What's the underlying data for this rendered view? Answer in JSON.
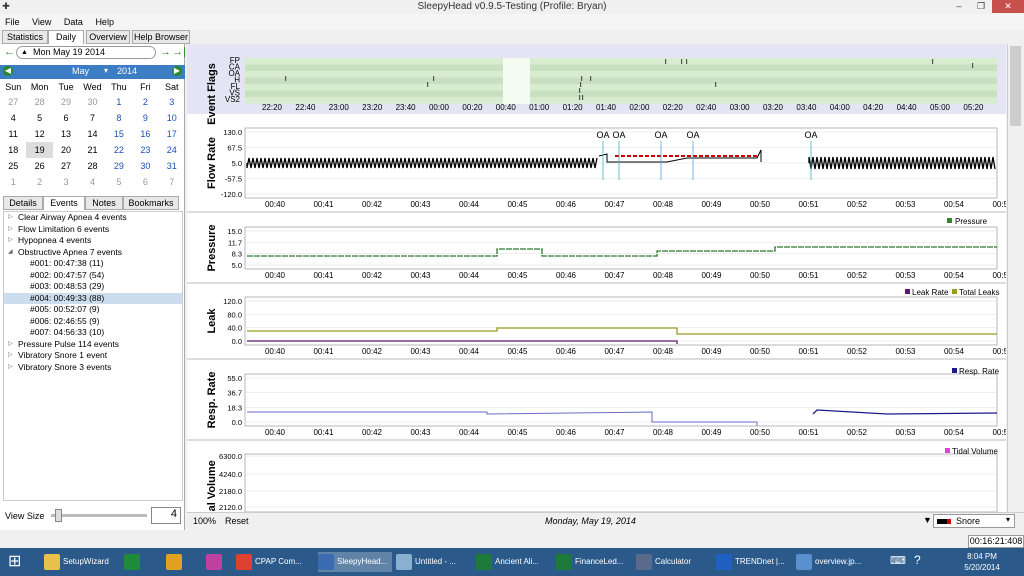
{
  "window": {
    "title": "SleepyHead v0.9.5-Testing (Profile: Bryan)"
  },
  "menu": [
    "File",
    "View",
    "Data",
    "Help"
  ],
  "tabs": [
    "Statistics",
    "Daily",
    "Overview",
    "Help Browser"
  ],
  "date": {
    "value": "Mon May 19 2014",
    "month": "May",
    "year": "2014"
  },
  "calendar": {
    "headers": [
      "Sun",
      "Mon",
      "Tue",
      "Wed",
      "Thu",
      "Fri",
      "Sat"
    ],
    "rows": [
      [
        "27",
        "28",
        "29",
        "30",
        "1",
        "2",
        "3"
      ],
      [
        "4",
        "5",
        "6",
        "7",
        "8",
        "9",
        "10"
      ],
      [
        "11",
        "12",
        "13",
        "14",
        "15",
        "16",
        "17"
      ],
      [
        "18",
        "19",
        "20",
        "21",
        "22",
        "23",
        "24"
      ],
      [
        "25",
        "26",
        "27",
        "28",
        "29",
        "30",
        "31"
      ],
      [
        "1",
        "2",
        "3",
        "4",
        "5",
        "6",
        "7"
      ]
    ]
  },
  "subtabs": [
    "Details",
    "Events",
    "Notes",
    "Bookmarks"
  ],
  "events": [
    "Clear Airway Apnea 4 events",
    "Flow Limitation 6 events",
    "Hypopnea 4 events",
    "Obstructive Apnea 7 events",
    "#001: 00:47:38 (11)",
    "#002: 00:47:57 (54)",
    "#003: 00:48:53 (29)",
    "#004: 00:49:33 (88)",
    "#005: 00:52:07 (9)",
    "#006: 02:46:55 (9)",
    "#007: 04:56:33 (10)",
    "Pressure Pulse 114 events",
    "Vibratory Snore 1 event",
    "Vibratory Snore 3 events"
  ],
  "viewsize": {
    "label": "View Size",
    "value": "4"
  },
  "graphs": {
    "flags": {
      "title": "Event Flags",
      "labels": [
        "FP",
        "CA",
        "OA",
        "H",
        "FL",
        "VS",
        "VS2"
      ],
      "ticks": [
        "22:20",
        "22:40",
        "23:00",
        "23:20",
        "23:40",
        "00:00",
        "00:20",
        "00:40",
        "01:00",
        "01:20",
        "01:40",
        "02:00",
        "02:20",
        "02:40",
        "03:00",
        "03:20",
        "03:40",
        "04:00",
        "04:20",
        "04:40",
        "05:00",
        "05:20"
      ]
    },
    "flow": {
      "title": "Flow Rate",
      "y": [
        "130.0",
        "67.5",
        "5.0",
        "-57.5",
        "-120.0"
      ],
      "oa": [
        "OA",
        "OA",
        "OA",
        "OA",
        "OA"
      ]
    },
    "pressure": {
      "title": "Pressure",
      "legend": "Pressure",
      "y": [
        "15.0",
        "11.7",
        "8.3",
        "5.0"
      ]
    },
    "leak": {
      "title": "Leak",
      "legend": "Leak Rate",
      "legend2": "Total Leaks",
      "y": [
        "120.0",
        "80.0",
        "40.0",
        "0.0"
      ]
    },
    "resp": {
      "title": "Resp. Rate",
      "legend": "Resp. Rate",
      "y": [
        "55.0",
        "36.7",
        "18.3",
        "0.0"
      ]
    },
    "tidal": {
      "title": "Tidal Volume",
      "legend": "Tidal Volume",
      "y": [
        "6300.0",
        "4240.0",
        "2180.0",
        "2120.0"
      ]
    },
    "ticks": [
      "00:40",
      "00:41",
      "00:42",
      "00:43",
      "00:44",
      "00:45",
      "00:46",
      "00:47",
      "00:48",
      "00:49",
      "00:50",
      "00:51",
      "00:52",
      "00:53",
      "00:54",
      "00:55"
    ]
  },
  "bottom": {
    "zoom": "100%",
    "reset": "Reset",
    "date": "Monday, May 19, 2014",
    "snore": "Snore"
  },
  "clock": "00:16:21:408",
  "taskbar": {
    "items": [
      "SetupWizard",
      "",
      "",
      "",
      "CPAP Com...",
      "SleepyHead...",
      "Untitled - ...",
      "Ancient Ali...",
      "FinanceLed...",
      "Calculator",
      "TRENDnet |...",
      "overview.jp..."
    ],
    "time": "8:04 PM",
    "date": "5/20/2014"
  }
}
